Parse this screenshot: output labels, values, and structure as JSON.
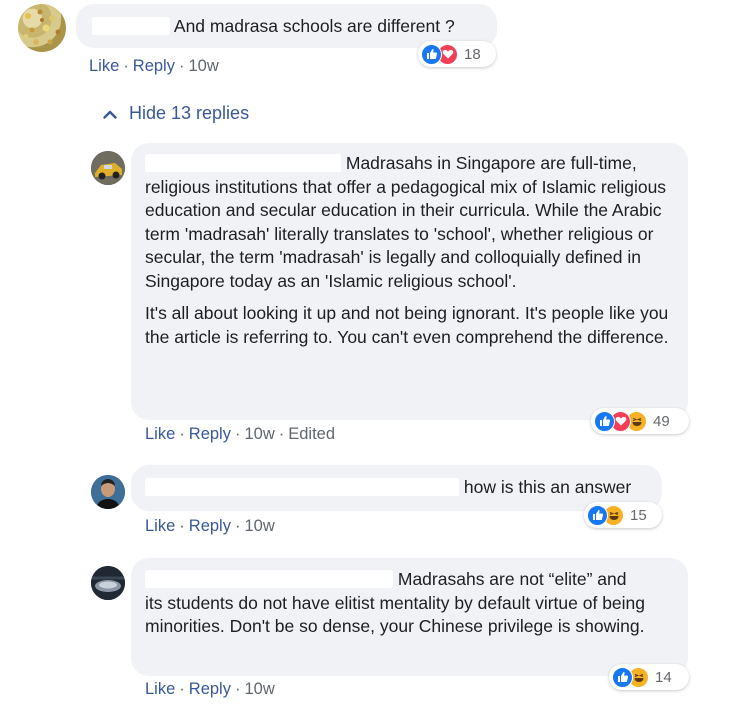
{
  "comment": {
    "text": "And madrasa schools are different ?",
    "reaction_count": "18",
    "actions": {
      "like": "Like",
      "reply": "Reply",
      "time": "10w"
    }
  },
  "hide_replies": {
    "label": "Hide 13 replies"
  },
  "replies": [
    {
      "first_line": "Madrasahs in Singapore are full-time,",
      "paragraph1": "religious institutions that offer a pedagogical mix of Islamic religious education and secular education in their curricula. While the Arabic term 'madrasah' literally translates to 'school', whether religious or secular, the term 'madrasah' is legally and colloquially defined in Singapore today as an 'Islamic religious school'.",
      "paragraph2": "It's all about looking it up and not being ignorant. It's people like you the article is referring to. You can't even comprehend the difference.",
      "reaction_count": "49",
      "actions": {
        "like": "Like",
        "reply": "Reply",
        "time": "10w",
        "edited": "Edited"
      }
    },
    {
      "text": "how is this an answer",
      "reaction_count": "15",
      "actions": {
        "like": "Like",
        "reply": "Reply",
        "time": "10w"
      }
    },
    {
      "first_line": "Madrasahs are not “elite” and",
      "rest": "its students do not have elitist mentality by default virtue of being minorities. Don't be so dense, your Chinese privilege is showing.",
      "reaction_count": "14",
      "actions": {
        "like": "Like",
        "reply": "Reply",
        "time": "10w"
      }
    }
  ],
  "colors": {
    "link": "#385898",
    "bubble": "#f0f2f5",
    "like": "#1877f2",
    "love": "#f33e58",
    "haha": "#f7b125"
  },
  "icons": [
    "like-icon",
    "love-icon",
    "haha-icon",
    "chevron-up-icon",
    "avatar"
  ]
}
